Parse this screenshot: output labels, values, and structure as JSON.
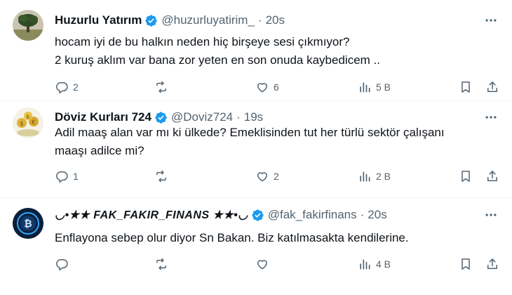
{
  "tweets": [
    {
      "name": "Huzurlu Yatırım",
      "handle": "@huzurluyatirim_",
      "time": "20s",
      "lines": [
        "hocam iyi de bu halkın neden hiç birşeye sesi çıkmıyor?",
        "2 kuruş aklım var bana zor yeten en son onuda kaybedicem .."
      ],
      "reply_count": "2",
      "like_count": "6",
      "views": "5 B"
    },
    {
      "name": "Döviz Kurları 724",
      "handle": "@Doviz724",
      "time": "19s",
      "lines": [
        "Adil maaş alan var mı ki ülkede? Emeklisinden tut her türlü sektör çalışanı",
        "maaşı adilce mi?"
      ],
      "reply_count": "1",
      "like_count": "2",
      "views": "2 B"
    },
    {
      "name": "◡•★★ FAK_FAKIR_FINANS ★★•◡",
      "handle": "@fak_fakirfinans",
      "time": "20s",
      "lines": [
        "Enflayona sebep olur diyor Sn Bakan. Biz katılmasakta kendilerine."
      ],
      "views": "4 B"
    }
  ],
  "colors": {
    "verified": "#1d9bf0",
    "icon": "#536471"
  },
  "icons": [
    "verified-badge-icon",
    "more-icon",
    "reply-icon",
    "retweet-icon",
    "like-icon",
    "views-icon",
    "bookmark-icon",
    "share-icon"
  ]
}
